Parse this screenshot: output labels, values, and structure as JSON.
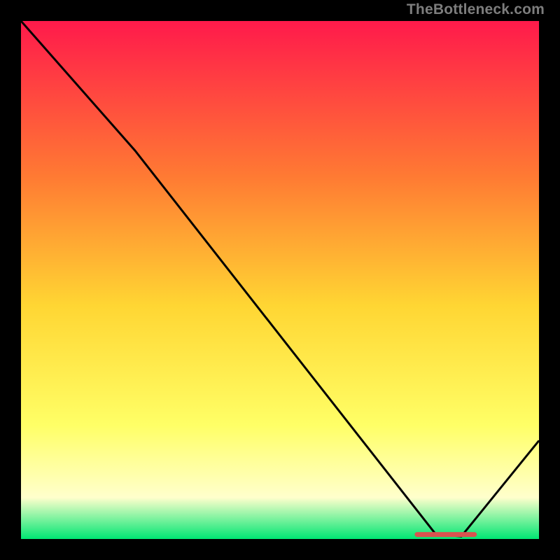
{
  "attribution": "TheBottleneck.com",
  "colors": {
    "gradient_top": "#ff1a4b",
    "gradient_mid1": "#ff7a33",
    "gradient_mid2": "#ffd633",
    "gradient_mid3": "#ffff66",
    "gradient_mid4": "#ffffcc",
    "gradient_bottom": "#00e673",
    "line": "#000000",
    "marker": "#d9534f",
    "background": "#000000"
  },
  "chart_data": {
    "type": "line",
    "title": "",
    "xlabel": "",
    "ylabel": "",
    "xlim": [
      0,
      100
    ],
    "ylim": [
      0,
      100
    ],
    "x": [
      0,
      22,
      80,
      85,
      100
    ],
    "values": [
      100,
      75,
      1,
      0.5,
      19
    ],
    "annotations": [
      {
        "type": "marker_band",
        "x_start": 76,
        "x_end": 88,
        "y": 0.8
      }
    ]
  }
}
